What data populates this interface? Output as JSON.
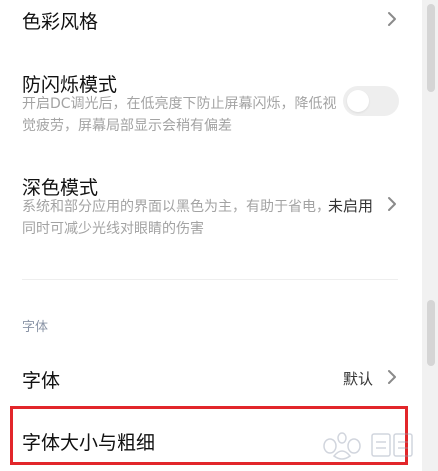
{
  "settings": {
    "color_style": {
      "title": "色彩风格"
    },
    "anti_flicker": {
      "title": "防闪烁模式",
      "description": "开启DC调光后，在低亮度下防止屏幕闪烁，降低视觉疲劳，屏幕局部显示会稍有偏差",
      "enabled": false
    },
    "dark_mode": {
      "title": "深色模式",
      "description": "系统和部分应用的界面以黑色为主，有助于省电，同时可减少光线对眼睛的伤害",
      "value": "未启用"
    },
    "font_section": {
      "label": "字体"
    },
    "font": {
      "title": "字体",
      "value": "默认"
    },
    "font_size_weight": {
      "title": "字体大小与粗细"
    }
  },
  "icons": {
    "chevron": "chevron-right-icon",
    "watermark": "baidu-jingyan-watermark"
  },
  "colors": {
    "highlight_border": "#e2262a",
    "text_primary": "#111111",
    "text_secondary": "#a3a3a3",
    "section_label": "#8a94a6"
  }
}
